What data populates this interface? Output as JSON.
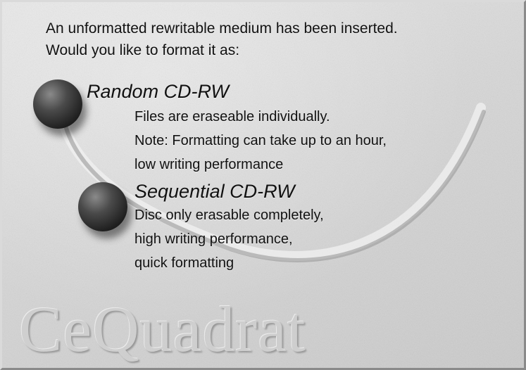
{
  "prompt": {
    "line1": "An unformatted rewritable medium has been inserted.",
    "line2": "Would you like to format it as:"
  },
  "options": [
    {
      "title": "Random CD-RW",
      "description": [
        "Files are eraseable individually.",
        "Note: Formatting can take up to an hour,",
        "low writing performance"
      ]
    },
    {
      "title": "Sequential CD-RW",
      "description": [
        "Disc only erasable completely,",
        "high writing performance,",
        "quick formatting"
      ]
    }
  ],
  "brand": "CeQuadrat",
  "icons": {
    "option_marker": "sphere-icon"
  },
  "colors": {
    "background": "#d4d4d4",
    "text": "#111111",
    "sphere": "#2a2a2a"
  }
}
